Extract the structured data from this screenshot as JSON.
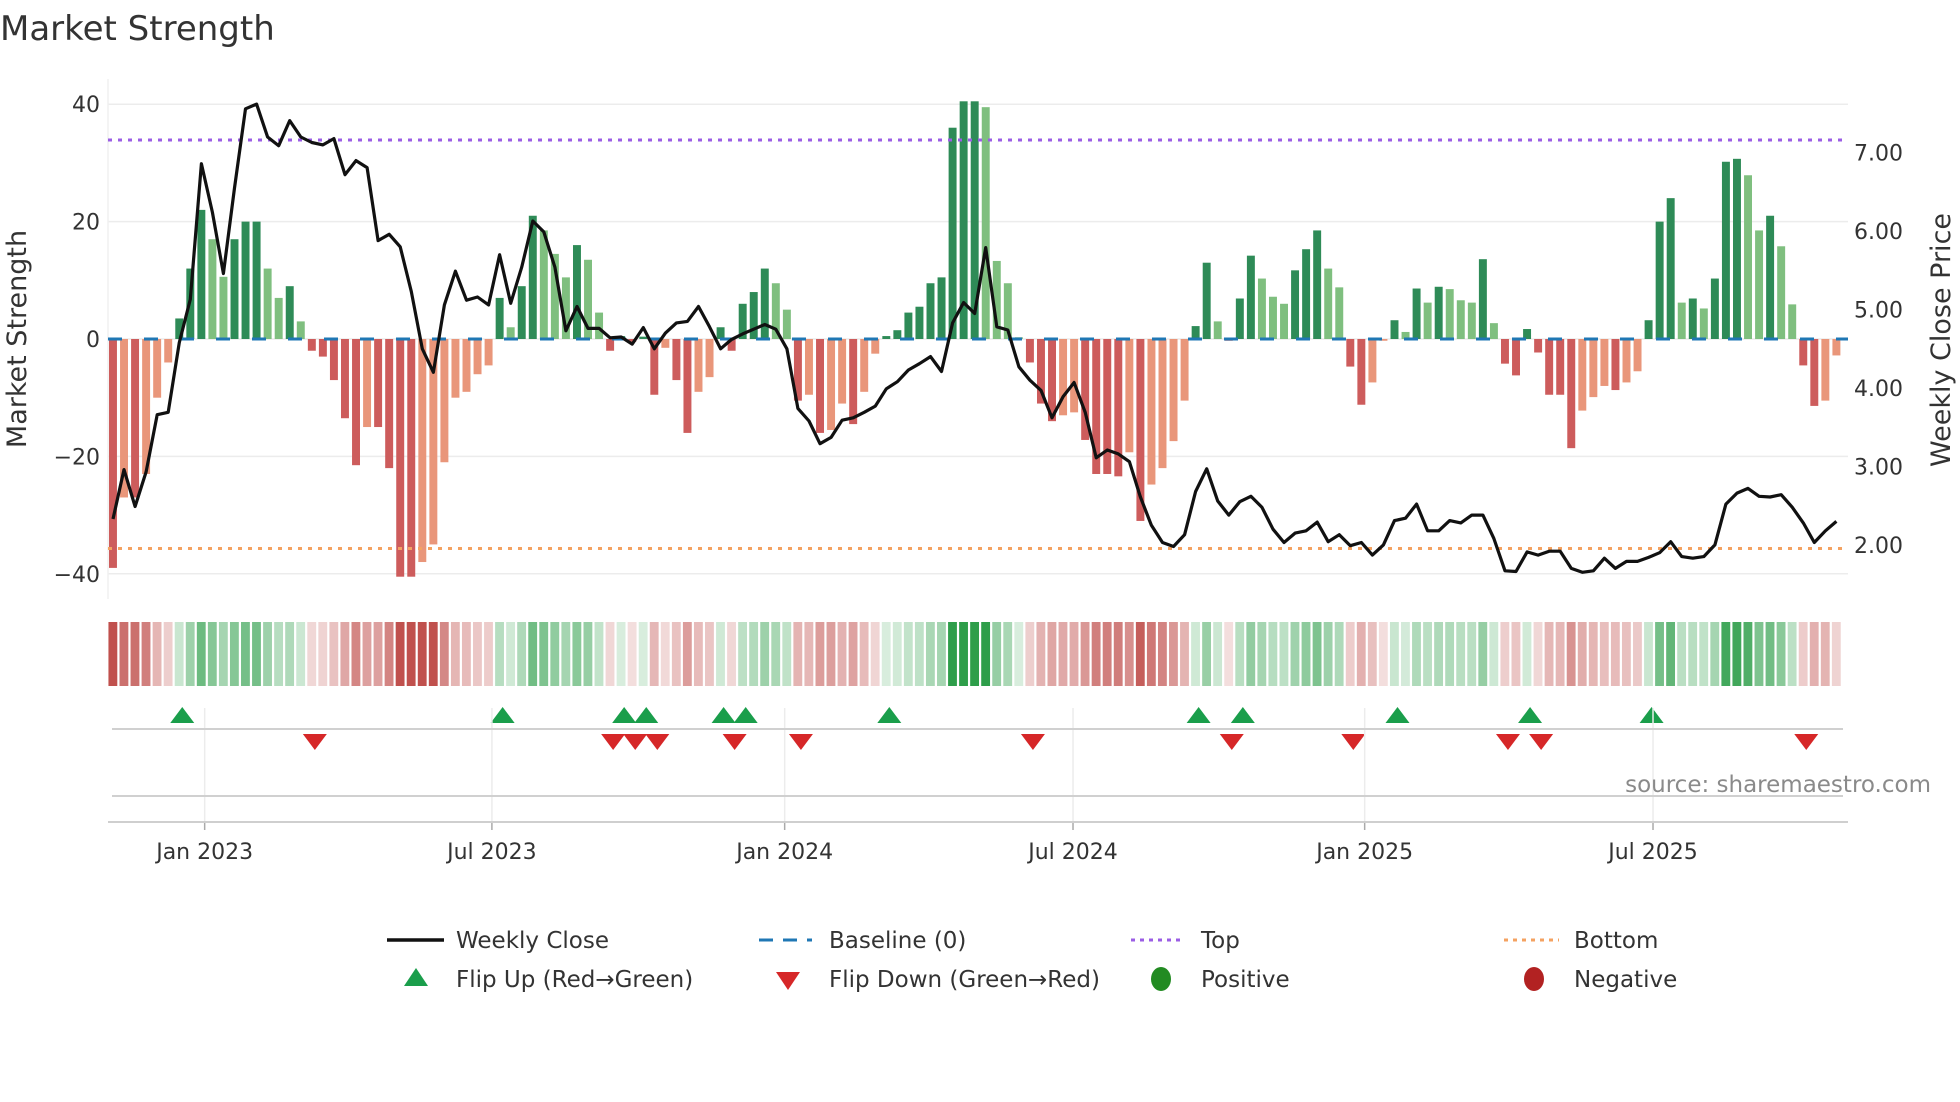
{
  "chart_data": {
    "type": "bar",
    "title": "Market Strength",
    "ylabel": "Market Strength",
    "ylabel_right": "Weekly Close Price",
    "ylim": [
      -44.3,
      44.3
    ],
    "ylim_right": [
      1.31,
      7.94
    ],
    "y_ticks": [
      {
        "v": 40,
        "label": "40"
      },
      {
        "v": 20,
        "label": "20"
      },
      {
        "v": 0,
        "label": "0"
      },
      {
        "v": -20,
        "label": "−20"
      },
      {
        "v": -40,
        "label": "−40"
      }
    ],
    "y_ticks_right": [
      {
        "v": 7,
        "label": "7.00"
      },
      {
        "v": 6,
        "label": "6.00"
      },
      {
        "v": 5,
        "label": "5.00"
      },
      {
        "v": 4,
        "label": "4.00"
      },
      {
        "v": 3,
        "label": "3.00"
      },
      {
        "v": 2,
        "label": "2.00"
      }
    ],
    "x_ticks": [
      {
        "week": 8.3,
        "label": "Jan 2023"
      },
      {
        "week": 34.3,
        "label": "Jul 2023"
      },
      {
        "week": 60.8,
        "label": "Jan 2024"
      },
      {
        "week": 86.9,
        "label": "Jul 2024"
      },
      {
        "week": 113.3,
        "label": "Jan 2025"
      },
      {
        "week": 139.4,
        "label": "Jul 2025"
      }
    ],
    "top_level": 33.9,
    "bottom_level": -35.7,
    "baseline": 0,
    "grid": true,
    "legend_placement": "bottom-center",
    "strength": [
      -39,
      -27,
      -27,
      -23,
      -10,
      -4,
      3.5,
      12,
      22,
      17,
      10.6,
      17,
      20,
      20,
      12,
      7,
      9,
      3,
      -2,
      -3,
      -7,
      -13.5,
      -21.5,
      -15,
      -15,
      -22,
      -40.5,
      -40.5,
      -38,
      -35,
      -21,
      -10,
      -9,
      -6,
      -4.5,
      7,
      2,
      9,
      21,
      18.5,
      14.5,
      10.5,
      16,
      13.5,
      4.5,
      -2,
      0.5,
      -0.5,
      0.4,
      -9.5,
      -1.5,
      -7,
      -16,
      -9,
      -6.5,
      2,
      -2,
      6,
      8,
      12,
      9.5,
      5,
      -10.5,
      -9.5,
      -16,
      -15.5,
      -11,
      -14.5,
      -9,
      -2.5,
      0.5,
      1.5,
      4.5,
      5.5,
      9.5,
      10.5,
      36,
      40.5,
      40.5,
      39.5,
      13.3,
      9.5,
      0.3,
      -4,
      -11,
      -14,
      -13,
      -12.5,
      -17.2,
      -23,
      -23,
      -23.4,
      -19.3,
      -31,
      -24.8,
      -22,
      -17.4,
      -10.5,
      2.2,
      13,
      3,
      -0.3,
      6.9,
      14.2,
      10.3,
      7.2,
      6,
      11.7,
      15.3,
      18.5,
      12,
      8.8,
      -4.7,
      -11.2,
      -7.4,
      -0.3,
      3.2,
      1.2,
      8.6,
      6.2,
      8.9,
      8.5,
      6.6,
      6.2,
      13.6,
      2.7,
      -4.2,
      -6.2,
      1.7,
      -2.3,
      -9.5,
      -9.5,
      -18.6,
      -12.2,
      -9.9,
      -8,
      -8.7,
      -7.4,
      -5.5,
      3.2,
      20,
      24,
      6.2,
      6.9,
      5.2,
      10.3,
      30.2,
      30.7,
      27.9,
      18.5,
      21,
      15.8,
      5.9,
      -4.5,
      -11.4,
      -10.5,
      -2.8
    ],
    "weekly_close": [
      2.33,
      2.96,
      2.49,
      2.93,
      3.66,
      3.69,
      4.58,
      5.13,
      6.86,
      6.24,
      5.46,
      6.55,
      7.56,
      7.62,
      7.2,
      7.09,
      7.41,
      7.2,
      7.13,
      7.1,
      7.18,
      6.72,
      6.9,
      6.81,
      5.88,
      5.96,
      5.8,
      5.23,
      4.5,
      4.2,
      5.06,
      5.49,
      5.12,
      5.16,
      5.06,
      5.7,
      5.08,
      5.54,
      6.13,
      5.99,
      5.54,
      4.73,
      5.04,
      4.76,
      4.76,
      4.64,
      4.65,
      4.56,
      4.77,
      4.5,
      4.7,
      4.83,
      4.85,
      5.04,
      4.78,
      4.5,
      4.62,
      4.69,
      4.75,
      4.81,
      4.75,
      4.5,
      3.74,
      3.58,
      3.29,
      3.37,
      3.59,
      3.62,
      3.69,
      3.77,
      3.99,
      4.08,
      4.23,
      4.31,
      4.4,
      4.21,
      4.83,
      5.09,
      4.95,
      5.79,
      4.78,
      4.74,
      4.27,
      4.1,
      3.97,
      3.62,
      3.89,
      4.07,
      3.69,
      3.11,
      3.21,
      3.16,
      3.06,
      2.61,
      2.25,
      2.03,
      1.98,
      2.13,
      2.68,
      2.97,
      2.56,
      2.38,
      2.55,
      2.62,
      2.48,
      2.2,
      2.03,
      2.15,
      2.18,
      2.29,
      2.04,
      2.13,
      1.99,
      2.03,
      1.87,
      2.0,
      2.31,
      2.34,
      2.52,
      2.18,
      2.18,
      2.31,
      2.28,
      2.38,
      2.38,
      2.08,
      1.67,
      1.66,
      1.91,
      1.87,
      1.92,
      1.92,
      1.7,
      1.65,
      1.67,
      1.83,
      1.7,
      1.79,
      1.79,
      1.84,
      1.9,
      2.04,
      1.85,
      1.83,
      1.85,
      2.0,
      2.52,
      2.66,
      2.72,
      2.62,
      2.61,
      2.64,
      2.48,
      2.28,
      2.03,
      2.18,
      2.3
    ],
    "legend": {
      "weekly_close": "Weekly Close",
      "baseline": "Baseline (0)",
      "top": "Top",
      "bottom": "Bottom",
      "flip_up": "Flip Up (Red→Green)",
      "flip_down": "Flip Down (Green→Red)",
      "positive": "Positive",
      "negative": "Negative"
    },
    "colors": {
      "pos_strong": "#2e8b57",
      "pos_weak": "#7fbf7f",
      "neg_strong": "#cd5c5c",
      "neg_weak": "#e9967a",
      "baseline": "#1f77b4",
      "top": "#9b5de5",
      "bottom": "#f4a261",
      "flip_up": "#1a9e4b",
      "flip_down": "#d62728",
      "positive": "#228b22",
      "negative": "#b22222",
      "close": "#111111"
    }
  },
  "source_note": "source: sharemaestro.com"
}
